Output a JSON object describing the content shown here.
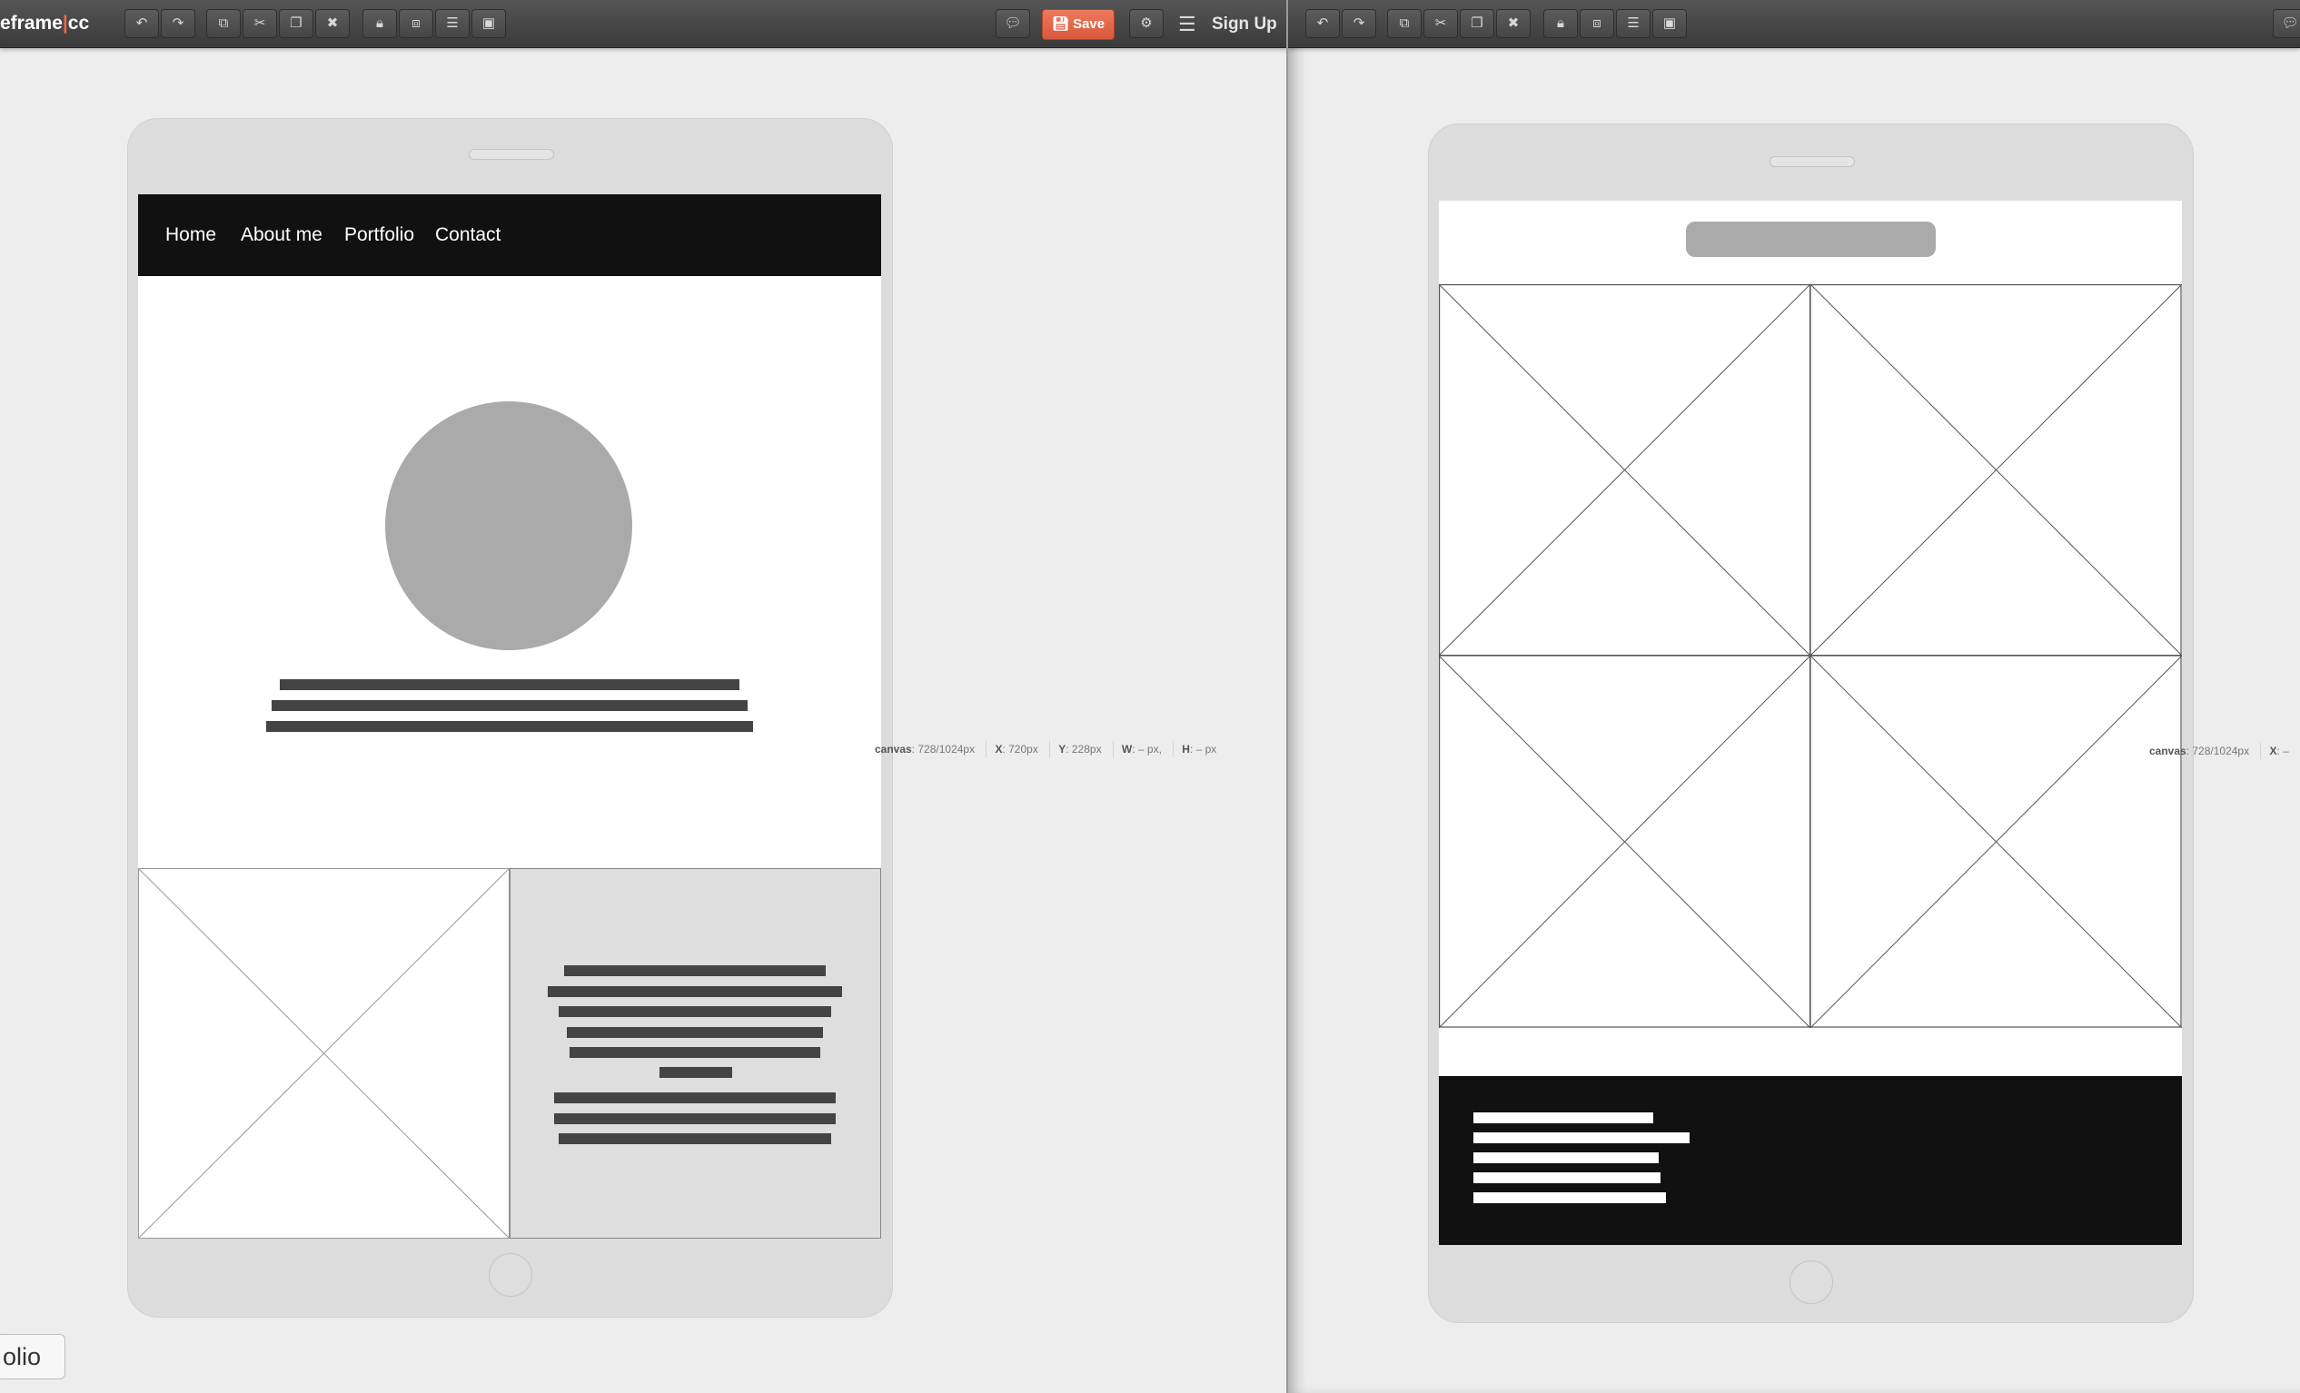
{
  "app": {
    "logo_prefix": "eframe",
    "logo_separator": "|",
    "logo_suffix": "cc",
    "accent_color": "#e8694a"
  },
  "toolbar": {
    "save_label": "Save",
    "signup_label": "Sign Up",
    "icons": [
      "undo-icon",
      "redo-icon",
      "copy-icon",
      "cut-icon",
      "paste-icon",
      "delete-icon",
      "lock-icon",
      "arrange-icon",
      "align-icon",
      "group-icon",
      "comment-icon",
      "settings-icon",
      "menu-icon"
    ]
  },
  "left_page": {
    "nav": [
      "Home",
      "About me",
      "Portfolio",
      "Contact"
    ]
  },
  "status_left": {
    "canvas_label": "canvas",
    "canvas_value": ": 728/1024px",
    "x_label": "X",
    "x_value": ": 720px",
    "y_label": "Y",
    "y_value": ": 228px",
    "w_label": "W",
    "w_value": ": – px,",
    "h_label": "H",
    "h_value": ": – px"
  },
  "status_right": {
    "canvas_label": "canvas",
    "canvas_value": ": 728/1024px",
    "x_label": "X",
    "x_value": ": –"
  },
  "bottom_tab": {
    "label": "olio"
  }
}
